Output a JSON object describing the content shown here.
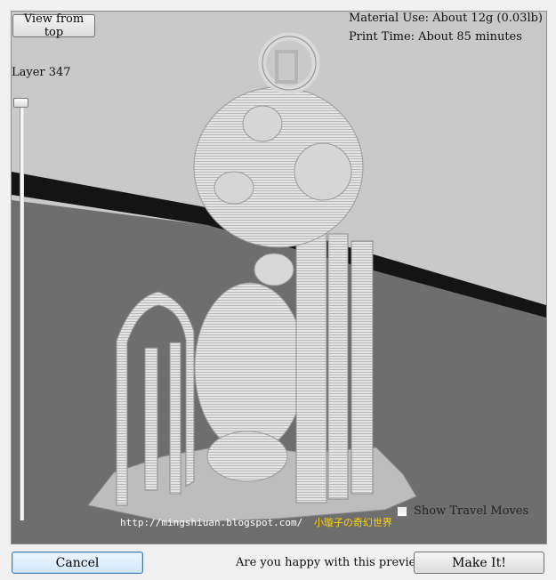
{
  "toolbar": {
    "view_from_top_label": "View from top"
  },
  "layer": {
    "label": "Layer 347",
    "slider_position": 0.02
  },
  "stats": {
    "material_use": "Material Use: About 12g (0.03lb)",
    "print_time": "Print Time: About 85 minutes"
  },
  "options": {
    "show_travel_moves_label": "Show Travel Moves",
    "show_travel_moves_checked": false
  },
  "watermark": {
    "url": "http://mingshiuan.blogspot.com/",
    "cjk": "小璇子の奇幻世界"
  },
  "footer": {
    "cancel_label": "Cancel",
    "question": "Are you happy with this preview?",
    "make_it_label": "Make It!"
  },
  "colors": {
    "background": "#c9c9c9",
    "model": "#e2e2e2",
    "platform": "#6f6f6f",
    "edge": "#141414"
  }
}
